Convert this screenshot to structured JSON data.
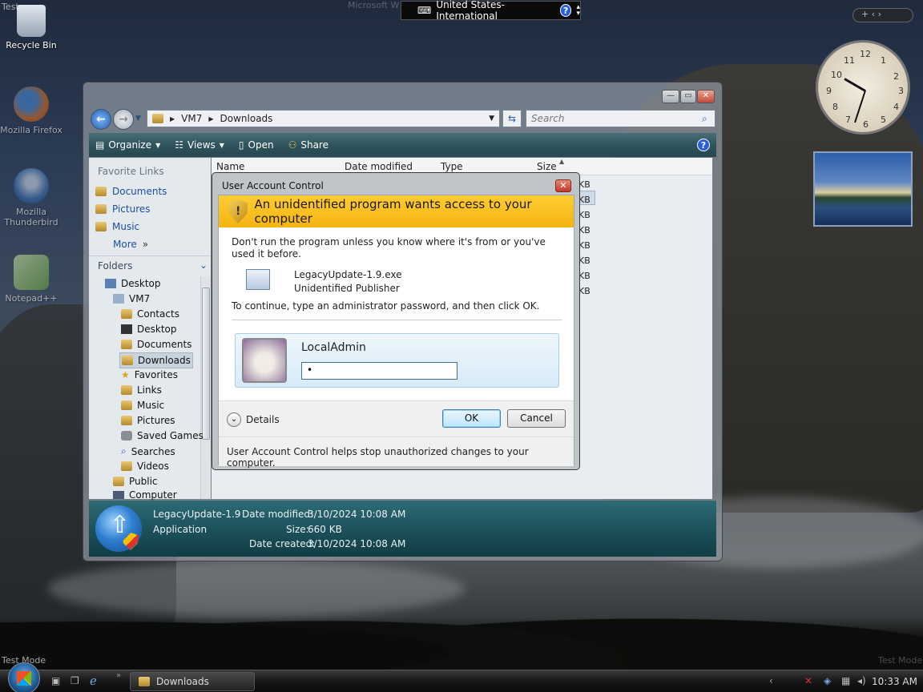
{
  "desktop": {
    "recycle_bin": "Recycle Bin",
    "firefox": "Mozilla Firefox",
    "thunderbird": "Mozilla Thunderbird",
    "notepad": "Notepad++",
    "test_mode_top": "Test",
    "test_mode_bottom_left": "Test Mode",
    "test_mode_bottom_right": "Test Mode",
    "faded_title": "Microsoft W"
  },
  "language_bar": {
    "label": "United States-International",
    "help": "?"
  },
  "clock_numbers": [
    "12",
    "1",
    "2",
    "3",
    "4",
    "5",
    "6",
    "7",
    "8",
    "9",
    "10",
    "11"
  ],
  "explorer": {
    "breadcrumb": [
      "VM7",
      "Downloads"
    ],
    "search_placeholder": "Search",
    "toolbar": {
      "organize": "Organize",
      "views": "Views",
      "open": "Open",
      "share": "Share"
    },
    "favorite_links_header": "Favorite Links",
    "favorite_links": [
      "Documents",
      "Pictures",
      "Music",
      "More"
    ],
    "folders_header": "Folders",
    "tree": [
      "Desktop",
      "VM7",
      "Contacts",
      "Desktop",
      "Documents",
      "Downloads",
      "Favorites",
      "Links",
      "Music",
      "Pictures",
      "Saved Games",
      "Searches",
      "Videos",
      "Public",
      "Computer"
    ],
    "columns": {
      "name": "Name",
      "date": "Date modified",
      "type": "Type",
      "size": "Size"
    },
    "size_units": [
      "KB",
      "KB",
      "KB",
      "KB",
      "KB",
      "KB",
      "KB",
      "KB"
    ],
    "details": {
      "file_name": "LegacyUpdate-1.9",
      "file_type": "Application",
      "date_modified_label": "Date modified:",
      "date_modified": "3/10/2024 10:08 AM",
      "size_label": "Size:",
      "size": "660 KB",
      "date_created_label": "Date created:",
      "date_created": "3/10/2024 10:08 AM"
    }
  },
  "uac": {
    "title": "User Account Control",
    "headline": "An unidentified program wants access to your computer",
    "warning": "Don't run the program unless you know where it's from or you've used it before.",
    "program_name": "LegacyUpdate-1.9.exe",
    "publisher": "Unidentified Publisher",
    "instruction": "To continue, type an administrator password, and then click OK.",
    "username": "LocalAdmin",
    "password_mask": "•",
    "details_label": "Details",
    "ok_label": "OK",
    "cancel_label": "Cancel",
    "footer_text": "User Account Control helps stop unauthorized changes to your computer."
  },
  "taskbar": {
    "active_window": "Downloads",
    "clock": "10:33 AM"
  }
}
